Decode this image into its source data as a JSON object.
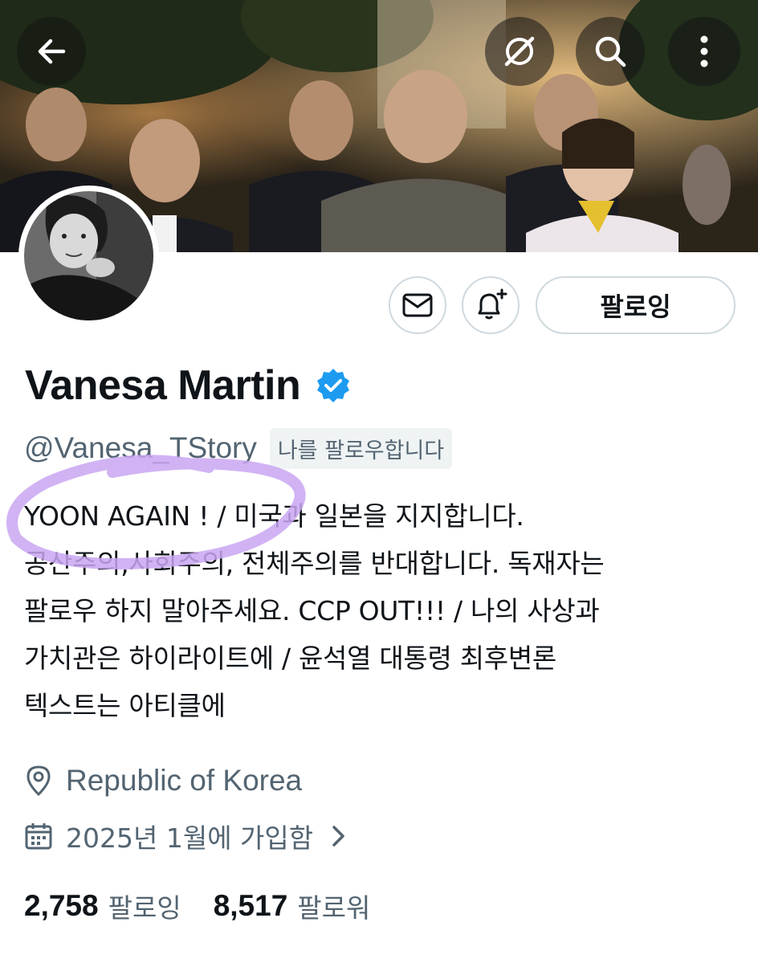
{
  "header": {
    "back_icon": "arrow-left-icon",
    "broadcast_icon": "satellite-off-icon",
    "search_icon": "search-icon",
    "more_icon": "more-vertical-icon"
  },
  "actions": {
    "message_icon": "envelope-icon",
    "notify_icon": "bell-plus-icon",
    "follow_label": "팔로잉"
  },
  "profile": {
    "display_name": "Vanesa Martin",
    "verified": true,
    "handle": "@Vanesa_TStory",
    "follows_you": "나를 팔로우합니다",
    "bio_lines": [
      "YOON AGAIN ! / 미국과 일본을 지지합니다.",
      "공산주의,사회주의, 전체주의를 반대합니다. 독재자는",
      "팔로우 하지 말아주세요. CCP OUT!!! / 나의 사상과",
      "가치관은 하이라이트에 / 윤석열 대통령 최후변론",
      "텍스트는 아티클에"
    ],
    "location": "Republic of Korea",
    "joined": "2025년 1월에 가입함"
  },
  "stats": {
    "following_count": "2,758",
    "following_label": "팔로잉",
    "followers_count": "8,517",
    "followers_label": "팔로워"
  },
  "colors": {
    "verified_blue": "#1d9bf0",
    "secondary_text": "#536471",
    "annotation_purple": "#c9a6f2"
  }
}
